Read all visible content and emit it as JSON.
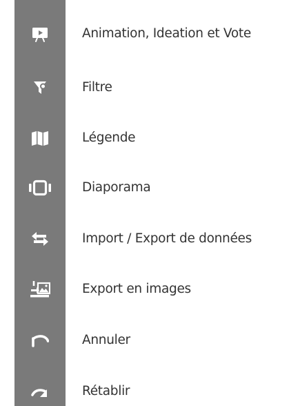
{
  "sidebar": {
    "background": "#7a7a7a",
    "icon_color": "#ffffff",
    "items": [
      {
        "icon": "presentation-icon",
        "label": "Animation, Ideation et Vote"
      },
      {
        "icon": "filter-icon",
        "label": "Filtre"
      },
      {
        "icon": "map-icon",
        "label": "Légende"
      },
      {
        "icon": "slideshow-icon",
        "label": "Diaporama"
      },
      {
        "icon": "swap-arrows-icon",
        "label": "Import / Export de données"
      },
      {
        "icon": "image-export-icon",
        "label": "Export en images"
      },
      {
        "icon": "undo-icon",
        "label": "Annuler"
      },
      {
        "icon": "redo-icon",
        "label": "Rétablir"
      }
    ]
  }
}
